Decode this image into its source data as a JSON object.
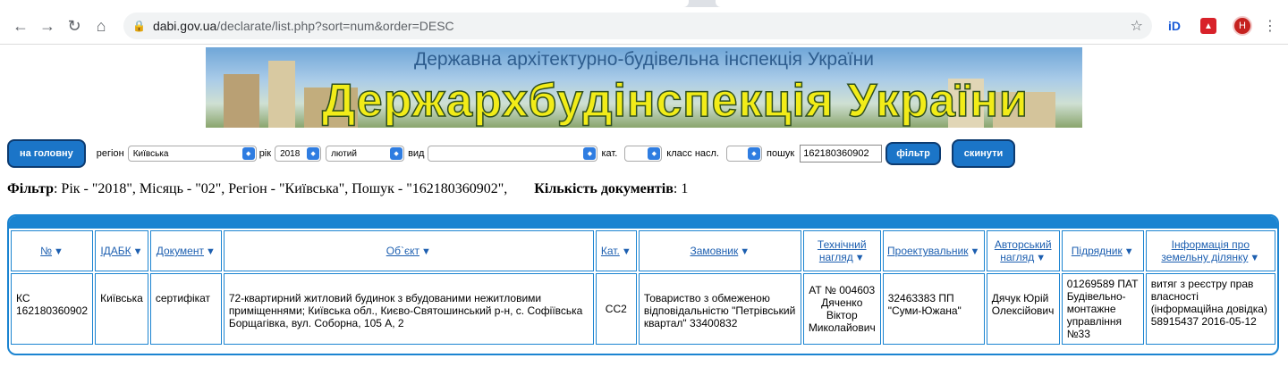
{
  "browser": {
    "url_host": "dabi.gov.ua",
    "url_path": "/declarate/list.php?sort=num&order=DESC",
    "profile_initial": "H",
    "ext_id_label": "iD"
  },
  "banner": {
    "subtitle": "Державна архітектурно-будівельна інспекція України",
    "title": "Держархбудінспекція України"
  },
  "toolbar": {
    "home_button": "на головну",
    "region_label": "регіон",
    "region_value": "Київська",
    "year_label": "рік",
    "year_value": "2018",
    "month_value": "лютий",
    "type_label": "вид",
    "type_value": "",
    "cat_label": "кат.",
    "cat_value": "",
    "class_label": "класс насл.",
    "class_value": "",
    "search_label": "пошук",
    "search_value": "162180360902",
    "filter_button": "фільтр",
    "reset_button": "скинути"
  },
  "summary": {
    "filter_label": "Фільтр",
    "filter_text": ": Рік - \"2018\", Місяць - \"02\", Регіон - \"Київська\", Пошук - \"162180360902\",",
    "count_label": "Кількість документів",
    "count_value": ": 1"
  },
  "table": {
    "headers": [
      "№",
      "ІДАБК",
      "Документ",
      "Об`єкт",
      "Кат.",
      "Замовник",
      "Технічний нагляд",
      "Проектувальник",
      "Авторський нагляд",
      "Підрядник",
      "Інформація про земельну ділянку"
    ],
    "row": {
      "num": "КС 162180360902",
      "idabk": "Київська",
      "doc": "сертифікат",
      "object": "72-квартирний житловий будинок з вбудованими нежитловими приміщеннями; Київська обл., Києво-Святошинський р-н, с. Софіївська Борщагівка, вул. Соборна, 105 А, 2",
      "cat": "СС2",
      "customer": "Товариство з обмеженою відповідальністю \"Петрівський квартал\" 33400832",
      "tech": "АТ № 004603 Дяченко Віктор Миколайович",
      "designer": "32463383 ПП \"Суми-Южана\"",
      "author": "Дячук Юрій Олексійович",
      "contractor": "01269589 ПАТ Будівельно-монтажне управління №33",
      "land": "витяг з реєстру прав власності (інформаційна довідка) 58915437 2016-05-12"
    }
  }
}
